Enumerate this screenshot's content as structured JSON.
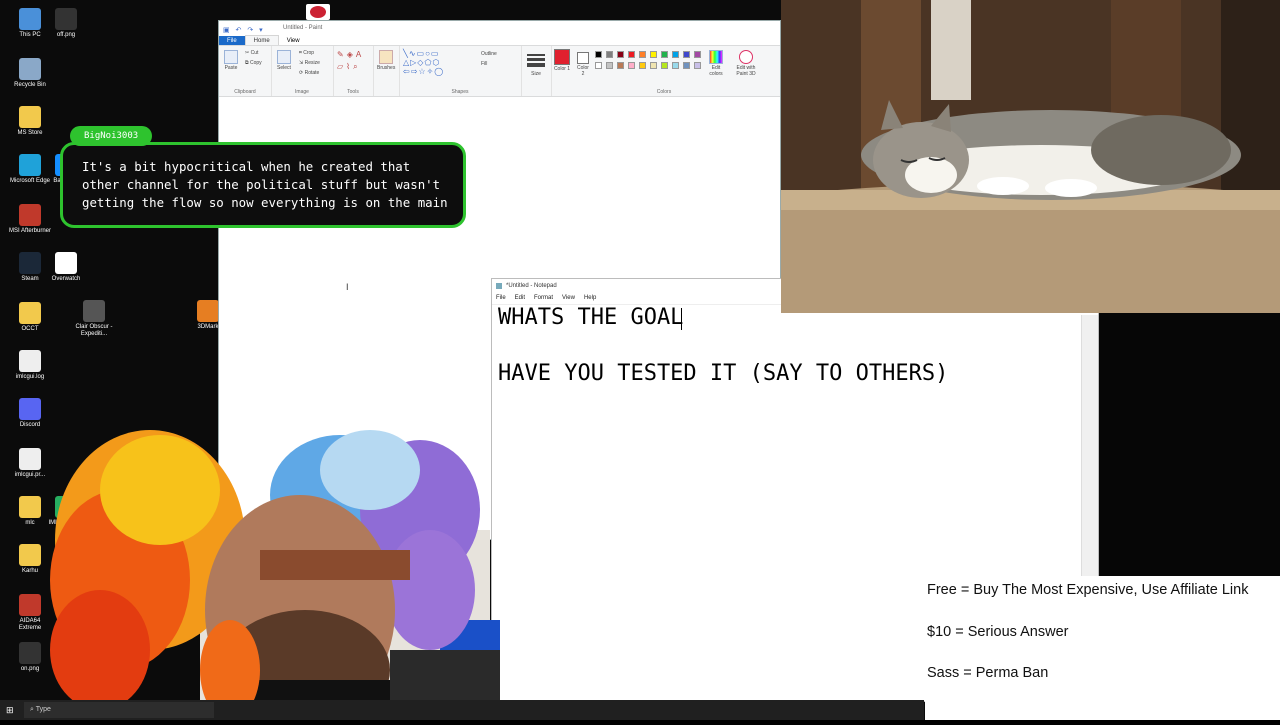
{
  "desktop": {
    "icons": [
      {
        "label": "This PC",
        "color": "#4a90d9"
      },
      {
        "label": "off.png",
        "color": "#333333"
      },
      {
        "label": "Recycle Bin",
        "color": "#8aa8c8"
      },
      {
        "label": "MS Store",
        "color": "#f2c94c"
      },
      {
        "label": "Microsoft Edge",
        "color": "#1fa2d9"
      },
      {
        "label": "Battle.n...",
        "color": "#148eff"
      },
      {
        "label": "MSI Afterburner",
        "color": "#c0392b"
      },
      {
        "label": "Steam",
        "color": "#1b2838"
      },
      {
        "label": "Overwatch",
        "color": "#ffffff"
      },
      {
        "label": "OCCT",
        "color": "#f2c94c"
      },
      {
        "label": "Clair Obscur - Expediti...",
        "color": "#555555"
      },
      {
        "label": "3DMark",
        "color": "#e67e22"
      },
      {
        "label": "imlcgui.log",
        "color": "#eeeeee"
      },
      {
        "label": "Discord",
        "color": "#5865f2"
      },
      {
        "label": "imlcgui.pr...",
        "color": "#eeeeee"
      },
      {
        "label": "mlc",
        "color": "#f2c94c"
      },
      {
        "label": "IMLCGui.exe",
        "color": "#27ae60"
      },
      {
        "label": "Karhu",
        "color": "#f2c94c"
      },
      {
        "label": "AIDA64 Extreme",
        "color": "#c0392b"
      },
      {
        "label": "on.png",
        "color": "#333333"
      }
    ]
  },
  "taskbar": {
    "start_glyph": "⊞",
    "search_placeholder": "Type"
  },
  "paint": {
    "title": "Untitled - Paint",
    "tabs": [
      "File",
      "Home",
      "View"
    ],
    "groups": {
      "clipboard": {
        "label": "Clipboard",
        "paste": "Paste",
        "cut": "Cut",
        "copy": "Copy"
      },
      "image": {
        "label": "Image",
        "select": "Select",
        "crop": "Crop",
        "resize": "Resize",
        "rotate": "Rotate"
      },
      "tools": {
        "label": "Tools"
      },
      "brushes": {
        "label": "Brushes"
      },
      "shapes": {
        "label": "Shapes",
        "outline": "Outline",
        "fill": "Fill"
      },
      "size": {
        "label": "Size"
      },
      "colors": {
        "label": "Colors",
        "color1": "Color 1",
        "color2": "Color 2",
        "edit_colors": "Edit colors",
        "edit_paint3d": "Edit with Paint 3D"
      }
    },
    "palette": [
      "#000000",
      "#7f7f7f",
      "#880015",
      "#ed1c24",
      "#ff7f27",
      "#fff200",
      "#22b14c",
      "#00a2e8",
      "#3f48cc",
      "#a349a4",
      "#ffffff",
      "#c3c3c3",
      "#b97a57",
      "#ffaec9",
      "#ffc90e",
      "#efe4b0",
      "#b5e61d",
      "#99d9ea",
      "#7092be",
      "#c8bfe7"
    ],
    "color1": "#e0202e",
    "color2": "#ffffff"
  },
  "chat": {
    "username": "BigNoi3003",
    "message_lines": [
      "It's a bit hypocritical when he created that",
      "other channel for the political stuff but wasn't",
      "getting the flow so now everything is on the main"
    ],
    "accent": "#2ec32e"
  },
  "notepad": {
    "title": "*Untitled - Notepad",
    "menu": [
      "File",
      "Edit",
      "Format",
      "View",
      "Help"
    ],
    "lines": [
      "WHATS THE GOAL",
      "HAVE YOU TESTED IT (SAY TO OTHERS)"
    ]
  },
  "rules": {
    "free": "Free = Buy The Most Expensive, Use Affiliate Link",
    "ten": "$10 = Serious Answer",
    "sass": "Sass = Perma Ban"
  }
}
